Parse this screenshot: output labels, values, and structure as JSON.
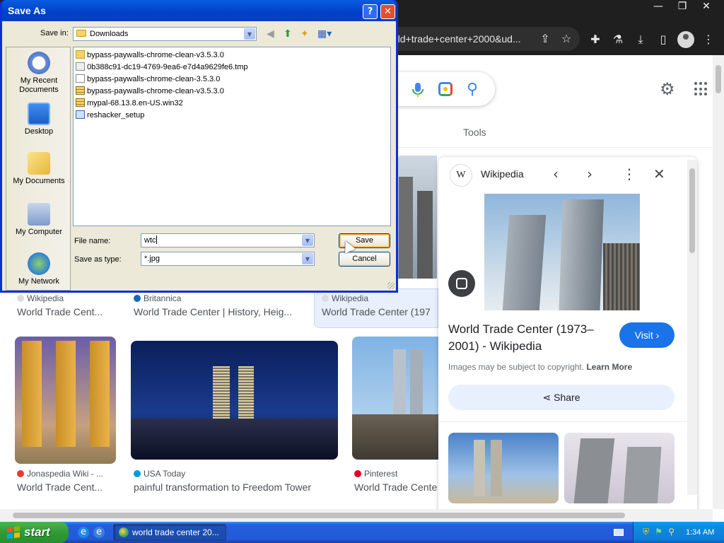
{
  "browser": {
    "address_fragment": "rld+trade+center+2000&ud...",
    "window_controls": [
      "minimize",
      "restore",
      "close"
    ]
  },
  "google": {
    "tools_label": "Tools",
    "results_row1": [
      {
        "source": "Wikipedia",
        "title": "World Trade Cent..."
      },
      {
        "source": "Britannica",
        "title": "World Trade Center | History, Heig..."
      },
      {
        "source": "Wikipedia",
        "title": "World Trade Center (197"
      }
    ],
    "results_row2": [
      {
        "source": "Jonaspedia Wiki - ...",
        "title": "World Trade Cent..."
      },
      {
        "source": "USA Today",
        "title": "painful transformation to Freedom Tower"
      },
      {
        "source": "Pinterest",
        "title": "World Trade Cente"
      }
    ],
    "panel": {
      "site_letter": "W",
      "site_name": "Wikipedia",
      "title": "World Trade Center (1973–2001) - Wikipedia",
      "visit_label": "Visit",
      "copyright_text": "Images may be subject to copyright.",
      "learn_more": "Learn More",
      "share_label": "Share"
    }
  },
  "dialog": {
    "title": "Save As",
    "save_in_label": "Save in:",
    "save_in_value": "Downloads",
    "places": [
      "My Recent Documents",
      "Desktop",
      "My Documents",
      "My Computer",
      "My Network"
    ],
    "files": [
      {
        "name": "bypass-paywalls-chrome-clean-v3.5.3.0",
        "icon": "folder-icon"
      },
      {
        "name": "0b388c91-dc19-4769-9ea6-e7d4a9629fe6.tmp",
        "icon": "tmp-file-icon"
      },
      {
        "name": "bypass-paywalls-chrome-clean-3.5.3.0",
        "icon": "file-icon"
      },
      {
        "name": "bypass-paywalls-chrome-clean-v3.5.3.0",
        "icon": "zip-icon"
      },
      {
        "name": "mypal-68.13.8.en-US.win32",
        "icon": "zip-icon"
      },
      {
        "name": "reshacker_setup",
        "icon": "installer-icon"
      }
    ],
    "file_name_label": "File name:",
    "file_name_value": "wtc",
    "save_type_label": "Save as type:",
    "save_type_value": "*.jpg",
    "save_button": "Save",
    "cancel_button": "Cancel"
  },
  "taskbar": {
    "start_label": "start",
    "task_label": "world trade center 20...",
    "clock": "1:34 AM"
  }
}
